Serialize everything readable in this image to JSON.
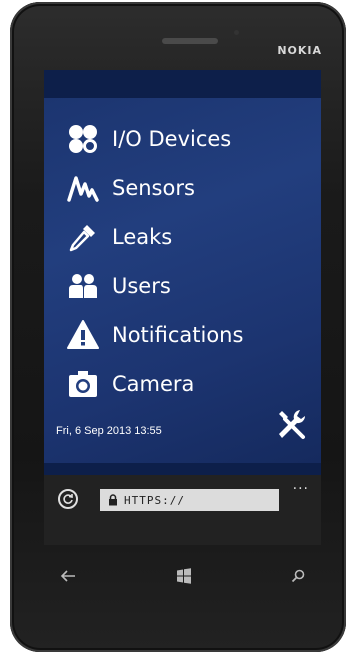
{
  "device": {
    "brand": "NOKIA"
  },
  "menu": {
    "items": [
      {
        "label": "I/O Devices",
        "icon": "io-devices-icon"
      },
      {
        "label": "Sensors",
        "icon": "sensor-wave-icon"
      },
      {
        "label": "Leaks",
        "icon": "dropper-icon"
      },
      {
        "label": "Users",
        "icon": "users-icon"
      },
      {
        "label": "Notifications",
        "icon": "warning-icon"
      },
      {
        "label": "Camera",
        "icon": "camera-icon"
      }
    ]
  },
  "status": {
    "datetime": "Fri, 6 Sep 2013 13:55"
  },
  "tools": {
    "icon": "tools-icon"
  },
  "browser": {
    "url": "HTTPS://",
    "more": "..."
  },
  "nav": {
    "back_icon": "back-arrow-icon",
    "start_icon": "windows-logo-icon",
    "search_icon": "search-icon"
  },
  "colors": {
    "panel": "#223e7e",
    "topbar": "#0d1f4a",
    "text": "#ffffff",
    "addressbar": "#222222",
    "url_field": "#dcdcdc"
  }
}
